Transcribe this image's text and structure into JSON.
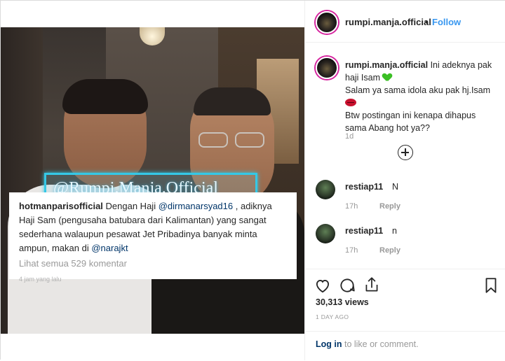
{
  "header": {
    "username": "rumpi.manja.official",
    "dot": "•",
    "follow_label": "Follow"
  },
  "photo": {
    "watermark": "@Rumpi.Manja.Official",
    "caption_username": "hotmanparisofficial",
    "caption_text_1": " Dengan Haji ",
    "caption_mention_1": "@dirmanarsyad16",
    "caption_text_2": " , adiknya Haji Sam (pengusaha batubara dari Kalimantan) yang sangat sederhana walaupun pesawat Jet Pribadinya banyak minta ampun, makan di ",
    "caption_mention_2": "@narajkt",
    "view_comments": "Lihat semua 529 komentar",
    "time_ago": "4 jam yang lalu"
  },
  "post": {
    "username": "rumpi.manja.official",
    "line1": " Ini adeknya pak haji Isam ",
    "line2": "Salam ya sama idola aku pak hj.Isam ",
    "line3": "Btw postingan ini kenapa dihapus sama Abang hot ya??",
    "age": "1d",
    "emoji_heart": "green-heart-emoji",
    "emoji_lips": "lips-emoji"
  },
  "comments": [
    {
      "username": "restiap11",
      "text": "N",
      "age": "17h",
      "reply_label": "Reply"
    },
    {
      "username": "restiap11",
      "text": "n",
      "age": "17h",
      "reply_label": "Reply"
    }
  ],
  "actions": {
    "icons": [
      "heart-icon",
      "comment-icon",
      "share-icon",
      "bookmark-icon"
    ],
    "likes": "30,313 views",
    "date": "1 DAY AGO"
  },
  "login": {
    "link": "Log in",
    "rest": " to like or comment."
  },
  "colors": {
    "follow_blue": "#3897f0",
    "link_dark_blue": "#003569",
    "muted_gray": "#999999",
    "watermark_cyan": "#35c8e6"
  }
}
